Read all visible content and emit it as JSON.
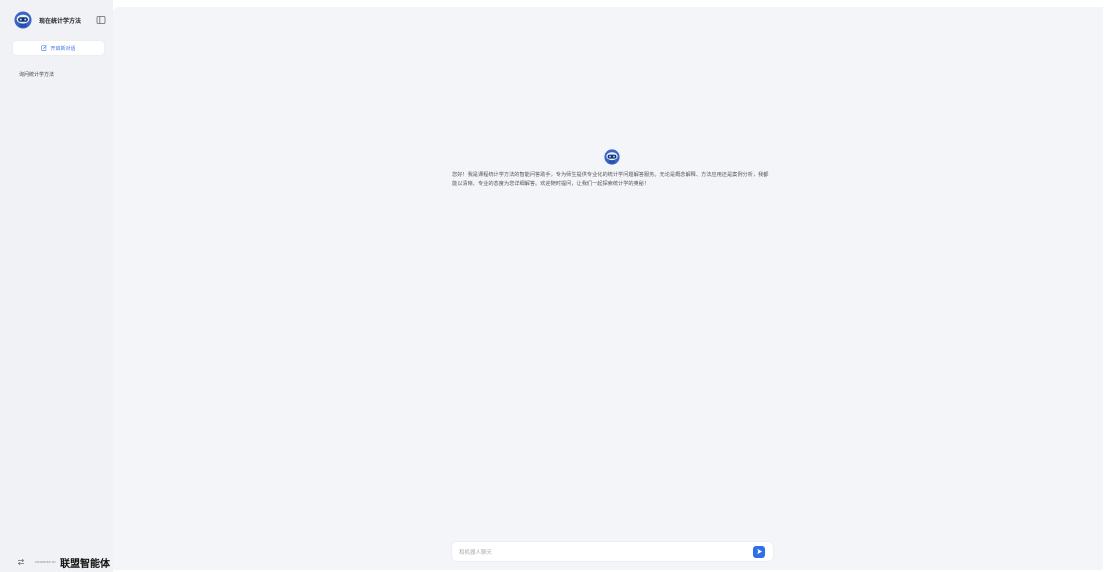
{
  "sidebar": {
    "app_title": "现在统计学方法",
    "new_chat_label": "开启新对话",
    "history": [
      {
        "label": "询问统计学方法"
      }
    ],
    "footer": {
      "powered_by": "POWERED BY",
      "brand": "联盟智能体"
    }
  },
  "main": {
    "welcome_text": "您好！我是课程统计学方法的智能问答助手，专为师生提供专业化的统计学问题解答服务。无论是概念解释、方法应用还是案例分析，我都能以清晰、专业的态度为您详细解答。欢迎随时提问，让我们一起探索统计学的奥秘！",
    "input": {
      "placeholder": "和机器人聊天",
      "value": ""
    }
  },
  "icons": {
    "avatar": "robot-avatar-icon",
    "collapse": "sidebar-toggle-icon",
    "new_chat": "edit-icon",
    "footer_swap": "swap-icon",
    "send": "send-icon"
  },
  "colors": {
    "accent": "#2f6fe8",
    "sidebar_bg": "#f1f2f5",
    "main_bg": "#f4f5f8"
  }
}
